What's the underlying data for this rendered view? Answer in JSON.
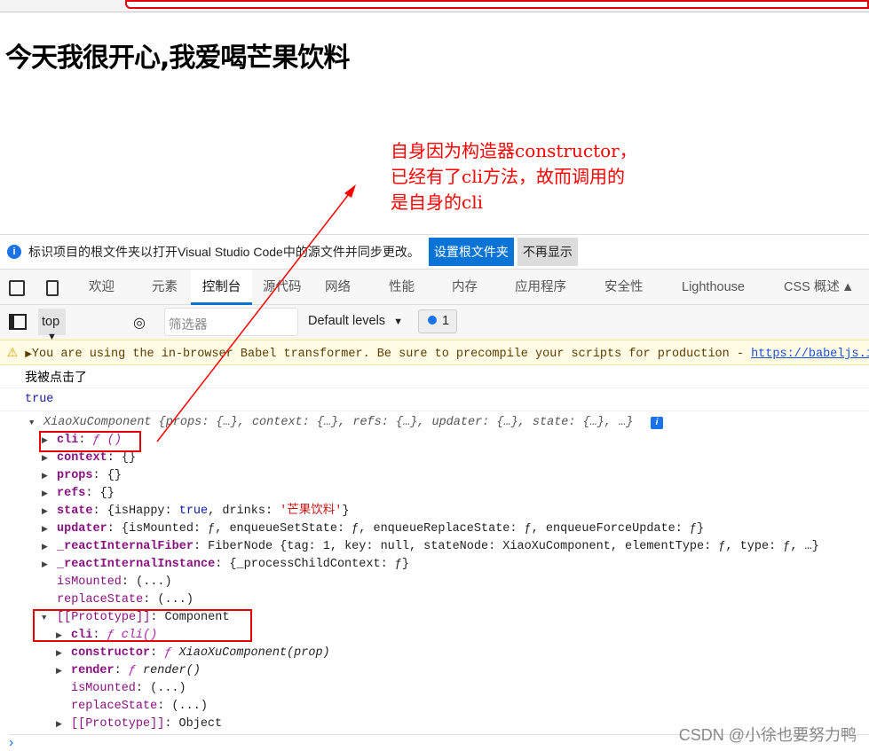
{
  "page": {
    "heading": "今天我很开心,我爱喝芒果饮料"
  },
  "annotation": {
    "lines": [
      "自身因为构造器constructor，",
      "已经有了cli方法，故而调用的",
      "是自身的cli"
    ],
    "color": "#ff0000"
  },
  "infobar": {
    "text": "标识项目的根文件夹以打开Visual Studio Code中的源文件并同步更改。",
    "set_root": "设置根文件夹",
    "dismiss": "不再显示"
  },
  "tabs": [
    {
      "label": "欢迎"
    },
    {
      "label": "元素"
    },
    {
      "label": "控制台",
      "active": true
    },
    {
      "label": "源代码"
    },
    {
      "label": "网络"
    },
    {
      "label": "性能"
    },
    {
      "label": "内存"
    },
    {
      "label": "应用程序"
    },
    {
      "label": "安全性"
    },
    {
      "label": "Lighthouse"
    },
    {
      "label": "CSS 概述"
    }
  ],
  "toolbar": {
    "context": "top",
    "filter_placeholder": "筛选器",
    "levels": "Default levels",
    "issues": "1"
  },
  "warning": {
    "text": "You are using the in-browser Babel transformer. Be sure to precompile your scripts for production - ",
    "link": "https://babeljs.io/docs/setup/"
  },
  "logs": [
    "我被点击了",
    "true"
  ],
  "object_rows": [
    {
      "indent": 0,
      "arrow": "open",
      "segs": [
        [
          "i",
          "XiaoXuComponent {props: {…}, context: {…}, refs: {…}, updater: {…}, state: {…}, …}"
        ]
      ]
    },
    {
      "indent": 1,
      "arrow": "closed",
      "segs": [
        [
          "k",
          "cli"
        ],
        [
          "p",
          ": "
        ],
        [
          "f",
          "ƒ ()"
        ]
      ]
    },
    {
      "indent": 1,
      "arrow": "closed",
      "segs": [
        [
          "k",
          "context"
        ],
        [
          "p",
          ": {}"
        ]
      ]
    },
    {
      "indent": 1,
      "arrow": "closed",
      "segs": [
        [
          "k",
          "props"
        ],
        [
          "p",
          ": {}"
        ]
      ]
    },
    {
      "indent": 1,
      "arrow": "closed",
      "segs": [
        [
          "k",
          "refs"
        ],
        [
          "p",
          ": {}"
        ]
      ]
    },
    {
      "indent": 1,
      "arrow": "closed",
      "segs": [
        [
          "k",
          "state"
        ],
        [
          "p",
          ": {isHappy: "
        ],
        [
          "kw",
          "true"
        ],
        [
          "p",
          ", drinks: "
        ],
        [
          "s",
          "'芒果饮料'"
        ],
        [
          "p",
          "}"
        ]
      ]
    },
    {
      "indent": 1,
      "arrow": "closed",
      "segs": [
        [
          "k",
          "updater"
        ],
        [
          "p",
          ": {isMounted: ƒ, enqueueSetState: ƒ, enqueueReplaceState: ƒ, enqueueForceUpdate: ƒ}"
        ]
      ]
    },
    {
      "indent": 1,
      "arrow": "closed",
      "segs": [
        [
          "k",
          "_reactInternalFiber"
        ],
        [
          "p",
          ": FiberNode {tag: 1, key: null, stateNode: XiaoXuComponent, elementType: ƒ, type: ƒ, …}"
        ]
      ]
    },
    {
      "indent": 1,
      "arrow": "closed",
      "segs": [
        [
          "k",
          "_reactInternalInstance"
        ],
        [
          "p",
          ": {_processChildContext: ƒ}"
        ]
      ]
    },
    {
      "indent": 1,
      "arrow": "none",
      "segs": [
        [
          "kn",
          "isMounted"
        ],
        [
          "p",
          ": (...)"
        ]
      ]
    },
    {
      "indent": 1,
      "arrow": "none",
      "segs": [
        [
          "kn",
          "replaceState"
        ],
        [
          "p",
          ": (...)"
        ]
      ]
    },
    {
      "indent": 1,
      "arrow": "open",
      "segs": [
        [
          "kn",
          "[[Prototype]]"
        ],
        [
          "p",
          ": Component"
        ]
      ]
    },
    {
      "indent": 2,
      "arrow": "closed",
      "segs": [
        [
          "k",
          "cli"
        ],
        [
          "p",
          ": "
        ],
        [
          "f",
          "ƒ cli()"
        ]
      ]
    },
    {
      "indent": 2,
      "arrow": "closed",
      "segs": [
        [
          "k",
          "constructor"
        ],
        [
          "p",
          ": "
        ],
        [
          "f",
          "ƒ "
        ],
        [
          "fi",
          "XiaoXuComponent(prop)"
        ]
      ]
    },
    {
      "indent": 2,
      "arrow": "closed",
      "segs": [
        [
          "k",
          "render"
        ],
        [
          "p",
          ": "
        ],
        [
          "f",
          "ƒ "
        ],
        [
          "fi",
          "render()"
        ]
      ]
    },
    {
      "indent": 2,
      "arrow": "none",
      "segs": [
        [
          "kn",
          "isMounted"
        ],
        [
          "p",
          ": (...)"
        ]
      ]
    },
    {
      "indent": 2,
      "arrow": "none",
      "segs": [
        [
          "kn",
          "replaceState"
        ],
        [
          "p",
          ": (...)"
        ]
      ]
    },
    {
      "indent": 2,
      "arrow": "closed",
      "segs": [
        [
          "kn",
          "[[Prototype]]"
        ],
        [
          "p",
          ": Object"
        ]
      ]
    }
  ],
  "watermark": "CSDN @小徐也要努力鸭"
}
